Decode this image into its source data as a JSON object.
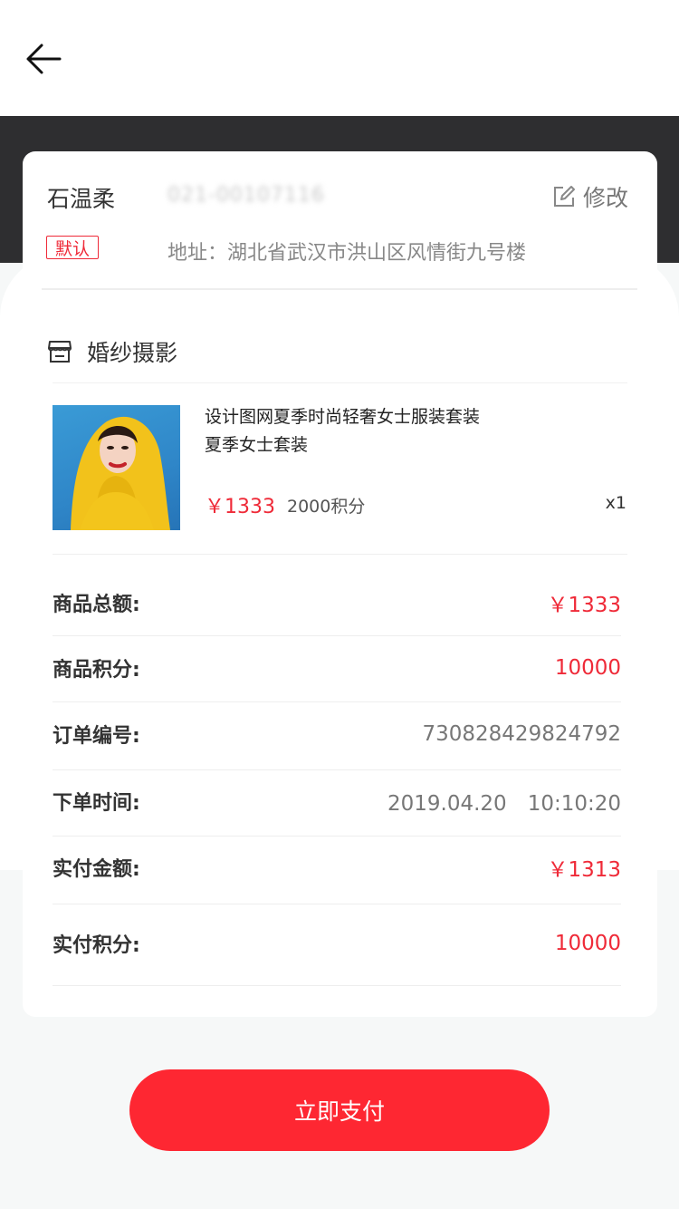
{
  "address": {
    "name": "石温柔",
    "phone": "021-00107116",
    "edit_label": "修改",
    "default_tag": "默认",
    "address_text": "地址：湖北省武汉市洪山区风情街九号楼"
  },
  "shop": {
    "name": "婚纱摄影"
  },
  "product": {
    "title_line1": "设计图网夏季时尚轻奢女士服装套装",
    "title_line2": "夏季女士套装",
    "price": "￥1333",
    "points": "2000积分",
    "quantity": "x1"
  },
  "order_details": [
    {
      "label": "商品总额:",
      "value": "￥1333",
      "highlight": true
    },
    {
      "label": "商品积分:",
      "value": "10000",
      "highlight": true
    },
    {
      "label": "订单编号:",
      "value": "730828429824792",
      "highlight": false
    },
    {
      "label": "下单时间:",
      "value": "2019.04.20　10:10:20",
      "highlight": false
    },
    {
      "label": "实付金额:",
      "value": "￥1313",
      "highlight": true
    },
    {
      "label": "实付积分:",
      "value": "10000",
      "highlight": true
    }
  ],
  "pay_button": {
    "label": "立即支付"
  },
  "colors": {
    "accent_red": "#ef2a38",
    "pay_button": "#fe2732",
    "dark_band": "#2e2e30"
  },
  "icons": {
    "back": "arrow-left-icon",
    "edit": "edit-icon",
    "shop": "store-icon"
  }
}
